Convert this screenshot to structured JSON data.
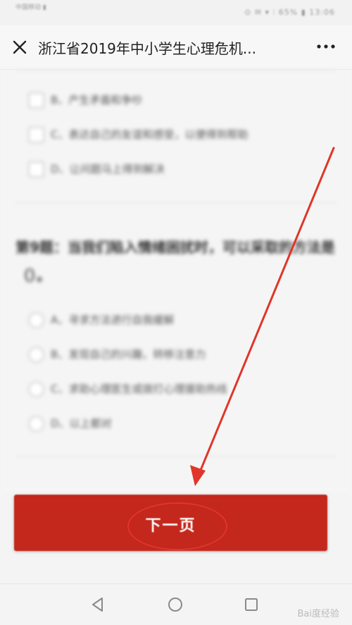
{
  "status_bar": {
    "left_text": "中国移动 ▮",
    "right_text": "⊙ ✉ ▾ ⫶ 65% ▮ 13:06"
  },
  "titlebar": {
    "title": "浙江省2019年中小学生心理危机..."
  },
  "prev_question": {
    "options": [
      {
        "letter": "B、",
        "text": "产生矛盾和争吵"
      },
      {
        "letter": "C、",
        "text": "表达自己的友谊和感受，以便得到帮助"
      },
      {
        "letter": "D、",
        "text": "让问题马上得到解决"
      }
    ]
  },
  "question": {
    "text": "第9题：当我们陷入情绪困扰时，可以采取的方法是（）。",
    "options": [
      {
        "letter": "A、",
        "text": "寻求方法进行自我缓解"
      },
      {
        "letter": "B、",
        "text": "发现自己的兴趣，转移注意力"
      },
      {
        "letter": "C、",
        "text": "求助心理医生或拨打心理援助热线"
      },
      {
        "letter": "D、",
        "text": "以上都对"
      }
    ]
  },
  "next_button": {
    "label": "下一页"
  },
  "watermark": {
    "text": "Bai度经验"
  },
  "colors": {
    "accent": "#c4271c",
    "annotation": "#e0352a"
  }
}
